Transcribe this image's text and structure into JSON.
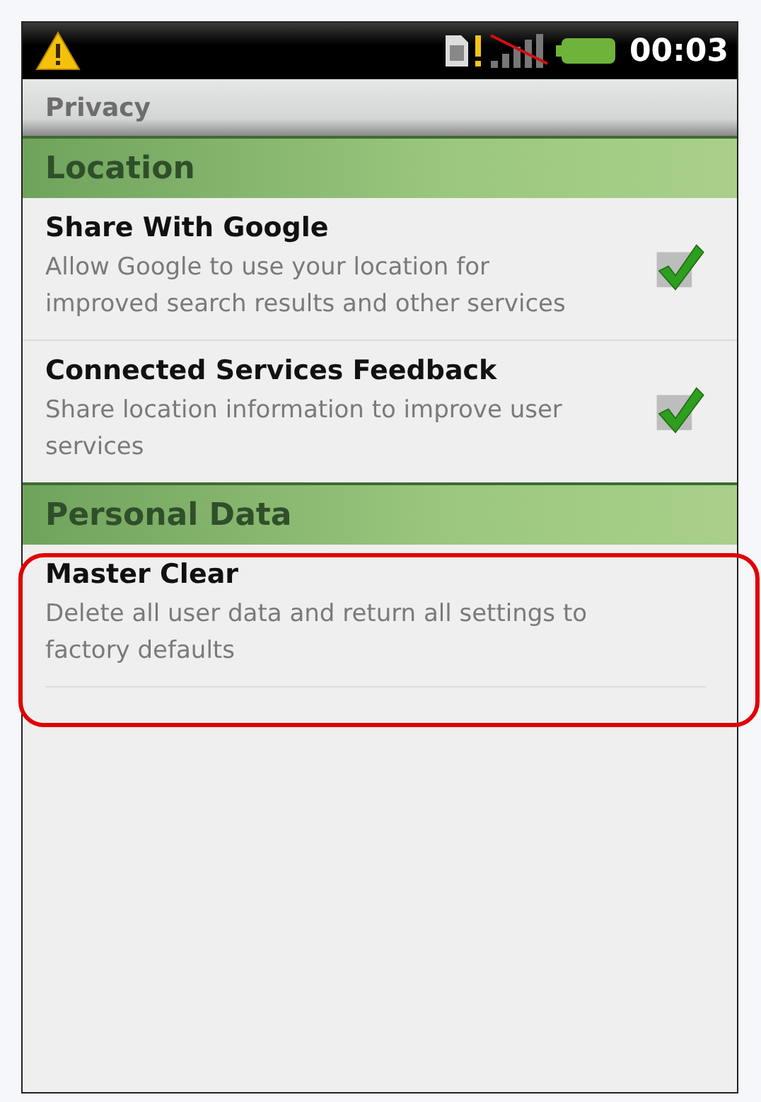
{
  "status_bar": {
    "time": "00:03"
  },
  "title": "Privacy",
  "sections": [
    {
      "header": "Location",
      "items": [
        {
          "kind": "checkbox",
          "title": "Share With Google",
          "summary": "Allow Google to use your location for improved search results and other services",
          "checked": true,
          "highlighted": false
        },
        {
          "kind": "checkbox",
          "title": "Connected Services Feedback",
          "summary": "Share location information to improve user services",
          "checked": true,
          "highlighted": false
        }
      ]
    },
    {
      "header": "Personal Data",
      "items": [
        {
          "kind": "action",
          "title": "Master Clear",
          "summary": "Delete all user data and return all settings to factory defaults",
          "highlighted": true
        }
      ]
    }
  ]
}
